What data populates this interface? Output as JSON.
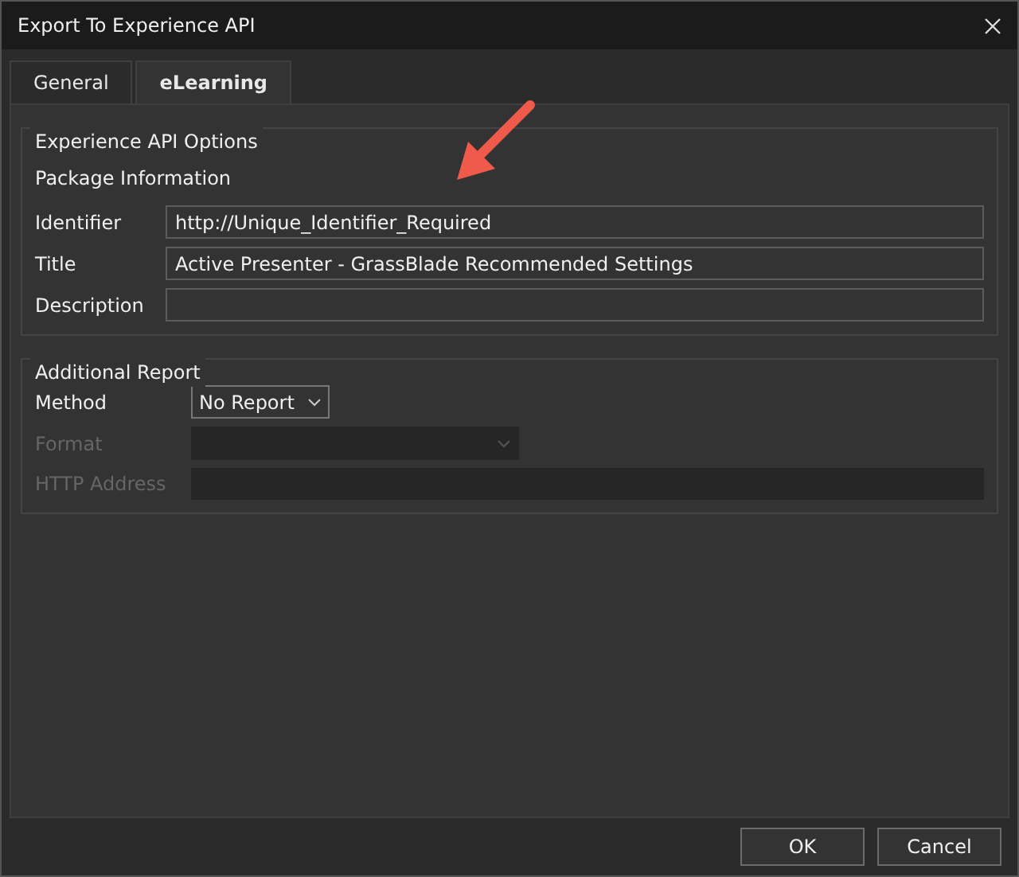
{
  "window": {
    "title": "Export To Experience API"
  },
  "tabs": [
    {
      "label": "General",
      "selected": false
    },
    {
      "label": "eLearning",
      "selected": true
    }
  ],
  "xapi_options": {
    "title": "Experience API Options",
    "section": "Package Information",
    "fields": [
      {
        "label": "Identifier",
        "value": "http://Unique_Identifier_Required"
      },
      {
        "label": "Title",
        "value": "Active Presenter - GrassBlade Recommended Settings"
      },
      {
        "label": "Description"
      }
    ]
  },
  "additional_report": {
    "title": "Additional Report",
    "rows": [
      {
        "kind": "select",
        "label": "Method",
        "value": "No Report",
        "disabled": false
      },
      {
        "kind": "select",
        "label": "Format",
        "disabled": true
      },
      {
        "kind": "text",
        "label": "HTTP Address",
        "disabled": true
      }
    ]
  },
  "buttons": [
    "OK",
    "Cancel"
  ]
}
